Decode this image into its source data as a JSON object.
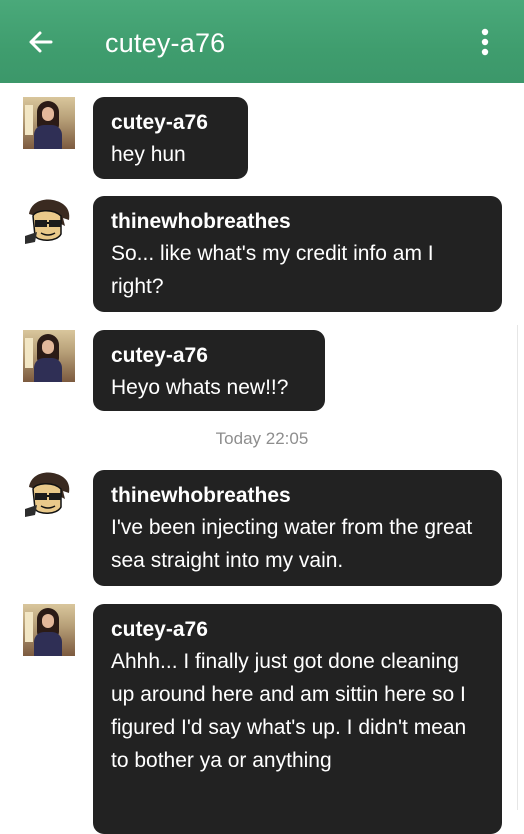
{
  "header": {
    "title": "cutey-a76",
    "back_icon": "arrow-left-icon",
    "menu_icon": "more-vertical-icon",
    "color": "#45a374"
  },
  "messages": [
    {
      "sender": "cutey-a76",
      "text": "hey hun",
      "avatar": "photo-avatar"
    },
    {
      "sender": "thinewhobreathes",
      "text": "So... like what's my credit info am I right?",
      "avatar": "cartoon-avatar"
    },
    {
      "sender": "cutey-a76",
      "text": "Heyo whats new!!?",
      "avatar": "photo-avatar"
    },
    {
      "sender": "thinewhobreathes",
      "text": "I've been injecting water from the great sea straight into my vain.",
      "avatar": "cartoon-avatar"
    },
    {
      "sender": "cutey-a76",
      "text": "Ahhh... I finally just got done cleaning up around here and am sittin here so I figured I'd say what's up. I didn't mean to bother ya or anything",
      "avatar": "photo-avatar"
    }
  ],
  "timestamp": "Today 22:05",
  "colors": {
    "bubble": "#222222",
    "timestamp": "#8e8e8e"
  }
}
